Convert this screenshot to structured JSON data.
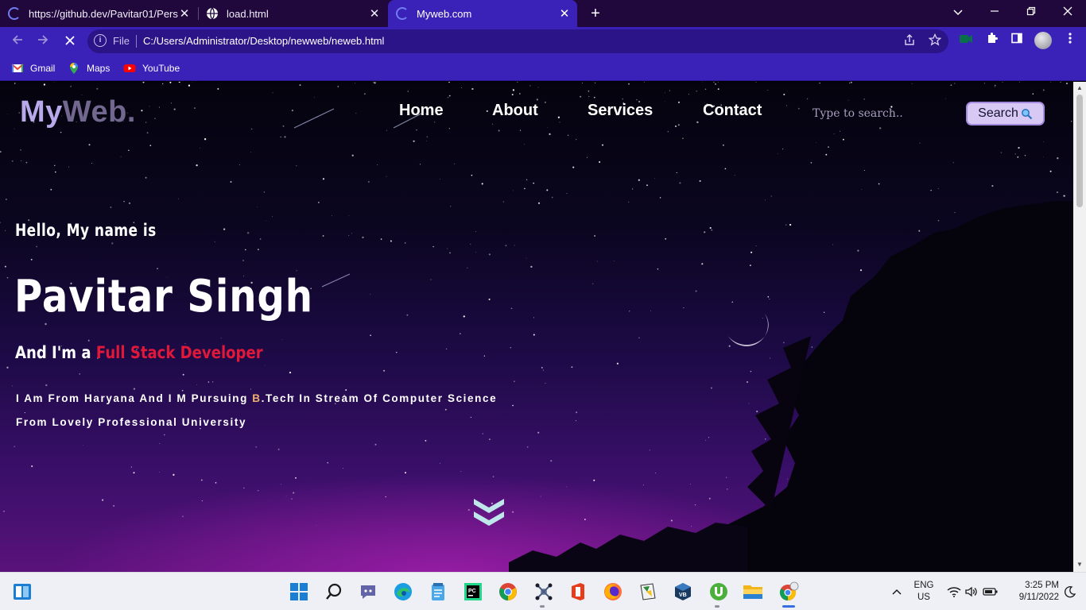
{
  "browser": {
    "tabs": [
      {
        "title": "https://github.dev/Pavitar01/Pers",
        "state": "loading"
      },
      {
        "title": "load.html",
        "state": "idle"
      },
      {
        "title": "Myweb.com",
        "state": "loading",
        "active": true
      }
    ],
    "tab_close_glyph": "✕",
    "new_tab_glyph": "+",
    "url_scheme_label": "File",
    "url": "C:/Users/Administrator/Desktop/newweb/neweb.html",
    "bookmarks": [
      "Gmail",
      "Maps",
      "YouTube"
    ],
    "colors": {
      "frame": "#20083c",
      "toolbar": "#3a22b9",
      "omnibox": "#2a1487"
    }
  },
  "page": {
    "logo": {
      "part1": "My",
      "part2": "Web."
    },
    "nav": [
      "Home",
      "About",
      "Services",
      "Contact"
    ],
    "search": {
      "placeholder": "Type to search..",
      "button_label": "Search"
    },
    "hero": {
      "greeting": "Hello, My name is",
      "name": "Pavitar Singh",
      "role_prefix": "And I'm a ",
      "role_highlight": "Full Stack Developer",
      "desc_part1": "I Am From Haryana And I M Pursuing ",
      "desc_highlight": "B",
      "desc_part2": ".Tech In Stream Of Computer Science",
      "desc_line2": "From Lovely Professional University"
    },
    "colors": {
      "highlight": "#e0183a",
      "logo_primary": "#b8a9ea",
      "logo_secondary": "#72688f",
      "search_button": "#d7c9f4"
    }
  },
  "taskbar": {
    "apps": [
      "start-icon",
      "search-icon",
      "teams-chat-icon",
      "edge-icon",
      "notepad-icon",
      "pycharm-icon",
      "chrome-icon",
      "drone-app-icon",
      "office-icon",
      "firefox-icon",
      "bluestacks-icon",
      "virtualbox-icon",
      "utorrent-icon",
      "file-explorer-icon",
      "chrome-canary-icon"
    ],
    "language_line1": "ENG",
    "language_line2": "US",
    "time": "3:25 PM",
    "date": "9/11/2022"
  }
}
